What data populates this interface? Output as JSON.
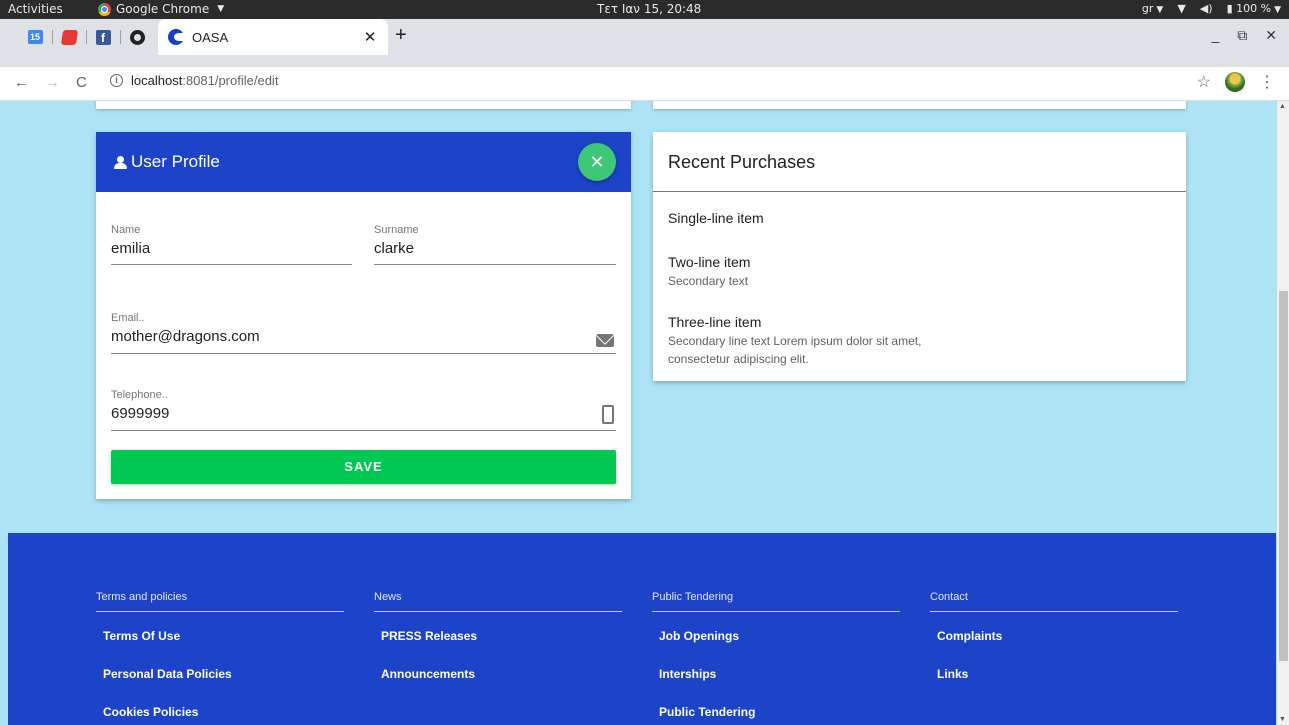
{
  "system_bar": {
    "activities": "Activities",
    "app": "Google Chrome",
    "clock": "Τετ Ιαν 15, 20:48",
    "keyboard": "gr",
    "battery": "100 %"
  },
  "browser": {
    "pinned_tabs": [
      {
        "icon": "calendar-icon",
        "text": "15"
      },
      {
        "icon": "red-app-icon",
        "text": ""
      },
      {
        "icon": "facebook-icon",
        "text": "f"
      },
      {
        "icon": "github-icon",
        "text": ""
      }
    ],
    "active_tab": {
      "title": "OASA",
      "icon": "oasa-icon"
    },
    "url_host": "localhost",
    "url_path": ":8081/profile/edit"
  },
  "profile": {
    "title": "User Profile",
    "name_label": "Name",
    "name_value": "emilia",
    "surname_label": "Surname",
    "surname_value": "clarke",
    "email_label": "Email..",
    "email_value": "mother@dragons.com",
    "phone_label": "Telephone..",
    "phone_value": "6999999",
    "save_label": "SAVE"
  },
  "purchases": {
    "title": "Recent Purchases",
    "items": [
      {
        "primary": "Single-line item",
        "secondary": ""
      },
      {
        "primary": "Two-line item",
        "secondary": "Secondary text"
      },
      {
        "primary": "Three-line item",
        "secondary": "Secondary line text Lorem ipsum dolor sit amet, consectetur adipiscing elit."
      }
    ]
  },
  "footer": {
    "columns": [
      {
        "heading": "Terms and policies",
        "links": [
          "Terms Of Use",
          "Personal Data Policies",
          "Cookies Policies"
        ]
      },
      {
        "heading": "News",
        "links": [
          "PRESS Releases",
          "Announcements"
        ]
      },
      {
        "heading": "Public Tendering",
        "links": [
          "Job Openings",
          "Interships",
          "Public Tendering"
        ]
      },
      {
        "heading": "Contact",
        "links": [
          "Complaints",
          "Links"
        ]
      }
    ]
  },
  "colors": {
    "page_bg": "#ade3f5",
    "brand_blue": "#1d44c8",
    "save_green": "#00c853",
    "fab_green": "#3ec777"
  }
}
